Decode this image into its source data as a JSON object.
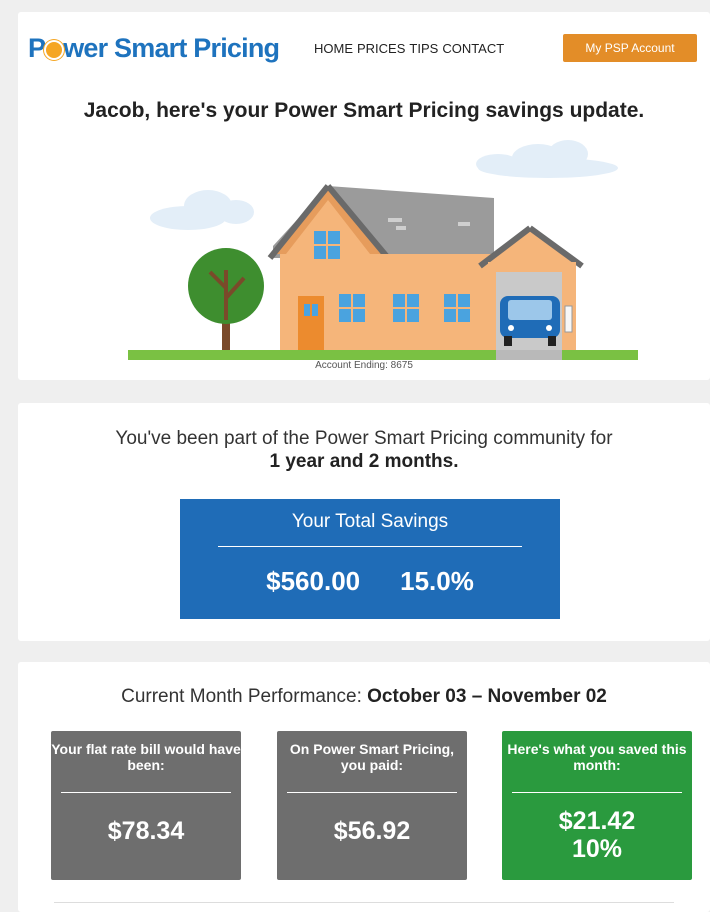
{
  "brand": {
    "logo_prefix": "P",
    "logo_rest": "wer Smart Pricing",
    "primary_color": "#1e73be",
    "accent_color": "#e38d28"
  },
  "nav": {
    "items": [
      "HOME",
      "PRICES",
      "TIPS",
      "CONTACT"
    ],
    "account_button": "My PSP Account"
  },
  "header": {
    "headline": "Jacob, here's your Power Smart Pricing savings update.",
    "account_ending": "Account Ending: 8675"
  },
  "membership": {
    "intro": "You've been part of the Power Smart Pricing community for",
    "duration": "1 year and 2 months."
  },
  "total_savings": {
    "title": "Your Total Savings",
    "amount": "$560.00",
    "percent": "15.0%",
    "color": "#1f6cb7"
  },
  "current_month": {
    "label": "Current Month Performance:",
    "range": "October 03 – November 02",
    "boxes": [
      {
        "label": "Your flat rate bill would have been:",
        "value": "$78.34",
        "color": "#6e6e6e"
      },
      {
        "label": "On Power Smart Pricing, you paid:",
        "value": "$56.92",
        "color": "#6e6e6e"
      },
      {
        "label": "Here's what you saved this month:",
        "value": "$21.42",
        "value2": "10%",
        "color": "#2a9a3e"
      }
    ]
  }
}
